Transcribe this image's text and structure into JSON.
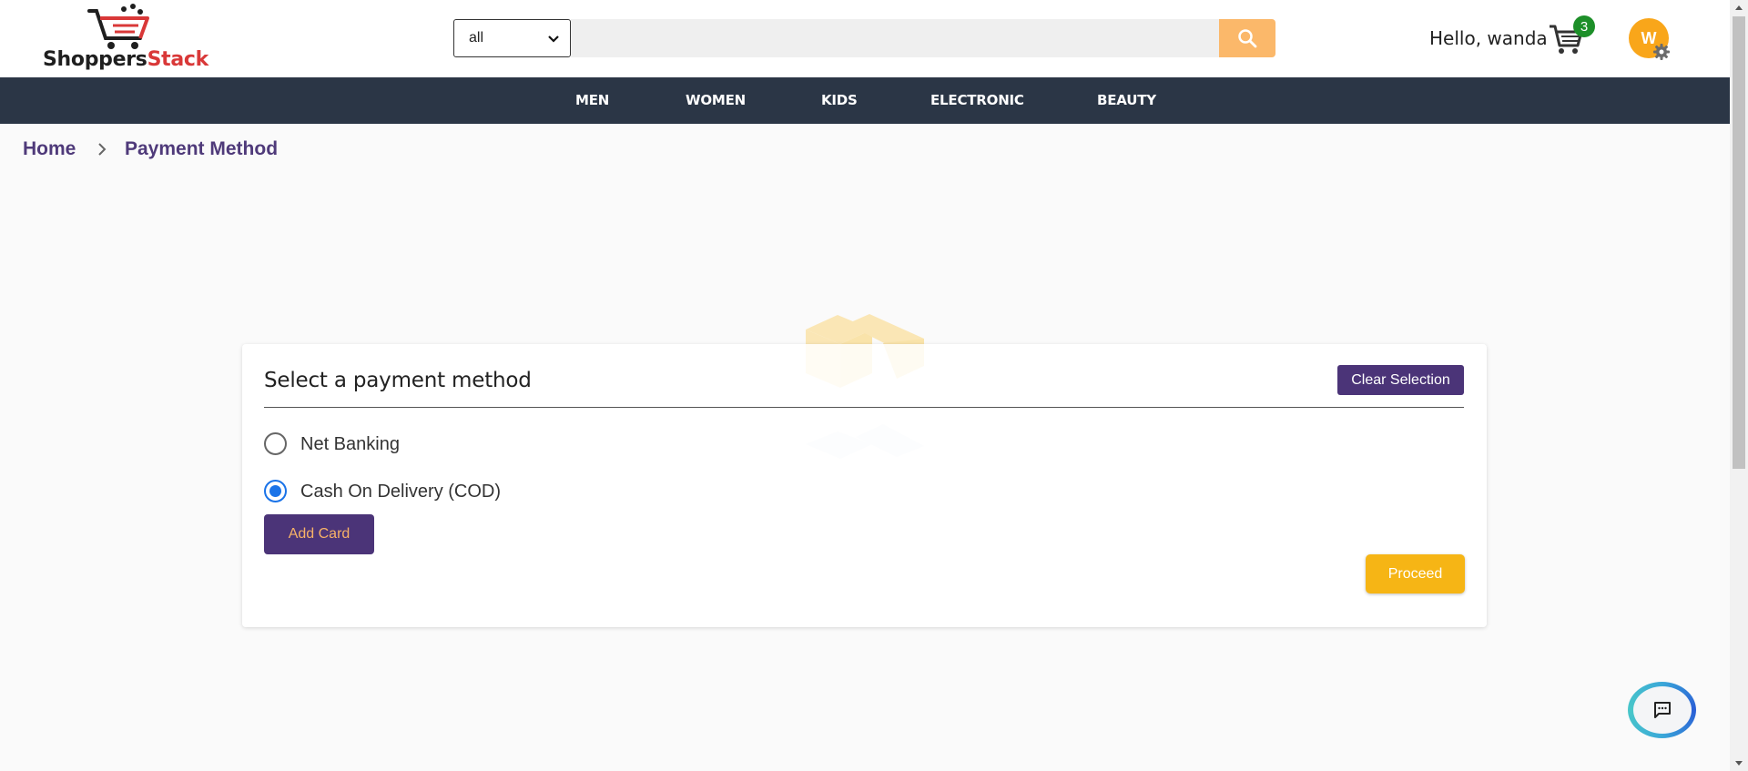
{
  "header": {
    "logo": {
      "part1": "Shoppers",
      "part2": "Stack"
    },
    "category_select": {
      "value": "all"
    },
    "search": {
      "placeholder": ""
    },
    "greeting": "Hello, wanda",
    "cart_count": "3",
    "avatar_initial": "W",
    "icons": [
      "cart-logo-icon",
      "chevron-down-icon",
      "search-icon",
      "cart-icon",
      "gear-icon"
    ]
  },
  "nav": {
    "items": [
      "MEN",
      "WOMEN",
      "KIDS",
      "ELECTRONIC",
      "BEAUTY"
    ]
  },
  "breadcrumb": {
    "home": "Home",
    "current": "Payment Method"
  },
  "payment": {
    "title": "Select a payment method",
    "clear_label": "Clear Selection",
    "options": [
      {
        "label": "Net Banking",
        "checked": false
      },
      {
        "label": "Cash On Delivery (COD)",
        "checked": true
      }
    ],
    "add_card_label": "Add Card",
    "proceed_label": "Proceed"
  },
  "colors": {
    "brand_purple": "#4b3478",
    "accent_yellow": "#f6b515",
    "nav_bg": "#2b3646",
    "cart_badge": "#1d8f29",
    "avatar_bg": "#f9a61a"
  }
}
